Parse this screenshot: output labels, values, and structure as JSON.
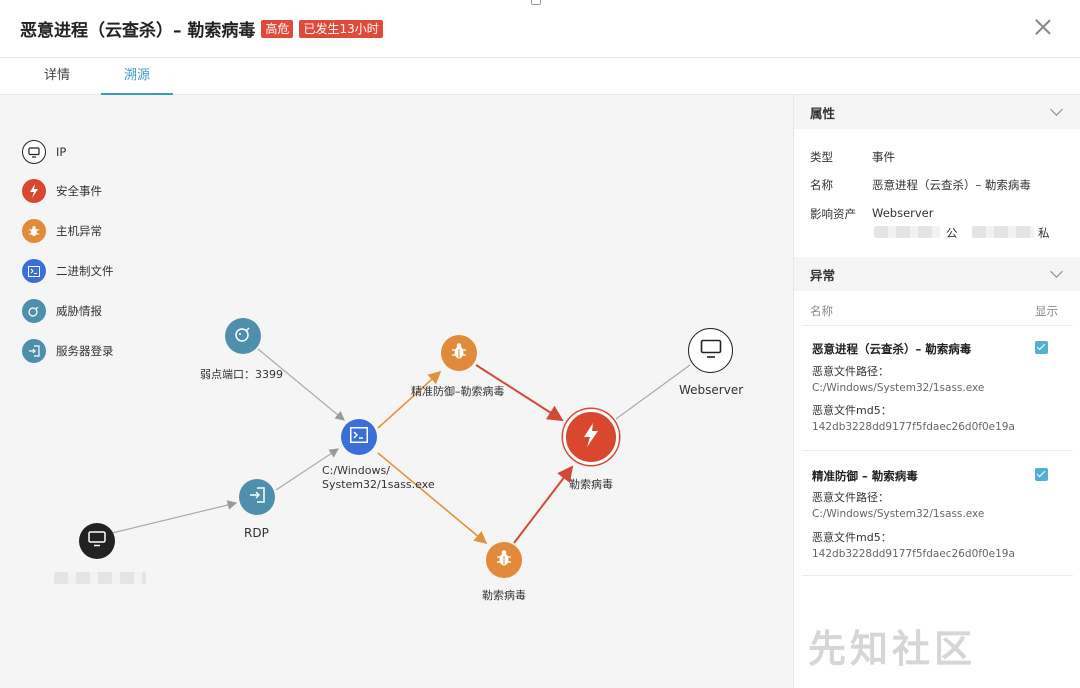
{
  "header": {
    "title": "恶意进程（云查杀）– 勒索病毒",
    "badge_level": "高危",
    "badge_time": "已发生13小时"
  },
  "tabs": [
    {
      "label": "详情",
      "active": false
    },
    {
      "label": "溯源",
      "active": true
    }
  ],
  "legend": [
    {
      "label": "IP",
      "icon": "monitor-icon",
      "color": "#222222"
    },
    {
      "label": "安全事件",
      "icon": "lightning-icon",
      "color": "#d9472f"
    },
    {
      "label": "主机异常",
      "icon": "bug-icon",
      "color": "#e08a3a"
    },
    {
      "label": "二进制文件",
      "icon": "terminal-icon",
      "color": "#3b6fd8"
    },
    {
      "label": "威胁情报",
      "icon": "bomb-icon",
      "color": "#4e8fab"
    },
    {
      "label": "服务器登录",
      "icon": "login-icon",
      "color": "#4e8fab"
    }
  ],
  "graph": {
    "nodes": {
      "threat": {
        "label": "弱点端口：3399"
      },
      "binary": {
        "label_line1": "C:/Windows/",
        "label_line2": "System32/1sass.exe"
      },
      "rdp": {
        "label": "RDP"
      },
      "host_ip": {
        "label": ""
      },
      "precise_defense": {
        "label": "精准防御–勒索病毒"
      },
      "ransom_anomaly": {
        "label": "勒索病毒"
      },
      "event": {
        "label": "勒索病毒"
      },
      "webserver": {
        "label": "Webserver"
      }
    }
  },
  "panel": {
    "properties": {
      "title": "属性",
      "type_key": "类型",
      "type_val": "事件",
      "name_key": "名称",
      "name_val": "恶意进程（云查杀）– 勒索病毒",
      "asset_key": "影响资产",
      "asset_val": "Webserver",
      "public_suffix": "公",
      "private_suffix": "私"
    },
    "anomaly": {
      "title": "异常",
      "col_name": "名称",
      "col_show": "显示",
      "items": [
        {
          "name": "恶意进程（云查杀）– 勒索病毒",
          "path_label": "恶意文件路径：",
          "path": "C:/Windows/System32/1sass.exe",
          "md5_label": "恶意文件md5：",
          "md5": "142db3228dd9177f5fdaec26d0f0e19a",
          "checked": true
        },
        {
          "name": "精准防御 – 勒索病毒",
          "path_label": "恶意文件路径：",
          "path": "C:/Windows/System32/1sass.exe",
          "md5_label": "恶意文件md5：",
          "md5": "142db3228dd9177f5fdaec26d0f0e19a",
          "checked": true
        }
      ]
    }
  },
  "watermark": "先知社区"
}
